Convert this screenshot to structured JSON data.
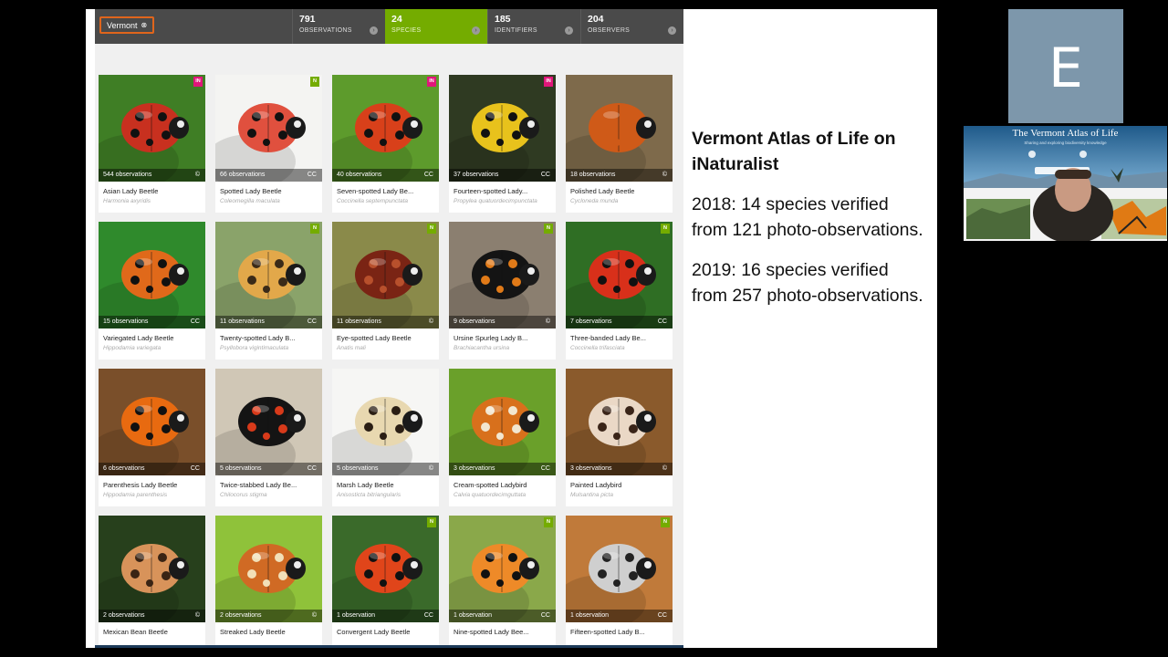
{
  "inat": {
    "place_filter": "Vermont",
    "stats": [
      {
        "count": "791",
        "label": "OBSERVATIONS",
        "active": false
      },
      {
        "count": "24",
        "label": "SPECIES",
        "active": true
      },
      {
        "count": "185",
        "label": "IDENTIFIERS",
        "active": false
      },
      {
        "count": "204",
        "label": "OBSERVERS",
        "active": false
      }
    ],
    "species": [
      {
        "common": "Asian Lady Beetle",
        "scientific": "Harmonia axyridis",
        "obs": "544 observations",
        "license": "©",
        "badge": "IN",
        "badge_color": "#e0167a",
        "bg": "#3f7e25",
        "body": "#c8301f",
        "spots": "#111"
      },
      {
        "common": "Spotted Lady Beetle",
        "scientific": "Coleomegilla maculata",
        "obs": "66 observations",
        "license": "CC",
        "badge": "N",
        "badge_color": "#74ac00",
        "bg": "#f4f4f2",
        "body": "#e0503e",
        "spots": "#111"
      },
      {
        "common": "Seven-spotted Lady Be...",
        "scientific": "Coccinella septempunctata",
        "obs": "40 observations",
        "license": "CC",
        "badge": "IN",
        "badge_color": "#e0167a",
        "bg": "#5d9b2c",
        "body": "#d8401a",
        "spots": "#111"
      },
      {
        "common": "Fourteen-spotted Lady...",
        "scientific": "Propylea quatuordecimpunctata",
        "obs": "37 observations",
        "license": "CC",
        "badge": "IN",
        "badge_color": "#e0167a",
        "bg": "#2f3a22",
        "body": "#e8c21c",
        "spots": "#111"
      },
      {
        "common": "Polished Lady Beetle",
        "scientific": "Cycloneda munda",
        "obs": "18 observations",
        "license": "©",
        "badge": "",
        "badge_color": "",
        "bg": "#7e6a4b",
        "body": "#cf5a18",
        "spots": "#cf5a18"
      },
      {
        "common": "Variegated Lady Beetle",
        "scientific": "Hippodamia variegata",
        "obs": "15 observations",
        "license": "CC",
        "badge": "",
        "badge_color": "",
        "bg": "#2f8a2c",
        "body": "#e0691a",
        "spots": "#111"
      },
      {
        "common": "Twenty-spotted Lady B...",
        "scientific": "Psyllobora vigintimaculata",
        "obs": "11 observations",
        "license": "CC",
        "badge": "N",
        "badge_color": "#74ac00",
        "bg": "#8aa36a",
        "body": "#e2a84a",
        "spots": "#3a2a18"
      },
      {
        "common": "Eye-spotted Lady Beetle",
        "scientific": "Anatis mali",
        "obs": "11 observations",
        "license": "©",
        "badge": "N",
        "badge_color": "#74ac00",
        "bg": "#8a8a4a",
        "body": "#7a2414",
        "spots": "#b8502c"
      },
      {
        "common": "Ursine Spurleg Lady B...",
        "scientific": "Brachiacantha ursina",
        "obs": "9 observations",
        "license": "©",
        "badge": "N",
        "badge_color": "#74ac00",
        "bg": "#8b7f70",
        "body": "#141414",
        "spots": "#e07a18"
      },
      {
        "common": "Three-banded Lady Be...",
        "scientific": "Coccinella trifasciata",
        "obs": "7 observations",
        "license": "CC",
        "badge": "N",
        "badge_color": "#74ac00",
        "bg": "#2f6e24",
        "body": "#d8301a",
        "spots": "#111"
      },
      {
        "common": "Parenthesis Lady Beetle",
        "scientific": "Hippodamia parenthesis",
        "obs": "6 observations",
        "license": "CC",
        "badge": "",
        "badge_color": "",
        "bg": "#7a4f2a",
        "body": "#e86a10",
        "spots": "#111"
      },
      {
        "common": "Twice-stabbed Lady Be...",
        "scientific": "Chilocorus stigma",
        "obs": "5 observations",
        "license": "CC",
        "badge": "",
        "badge_color": "",
        "bg": "#d0c7b6",
        "body": "#141414",
        "spots": "#d83a1a"
      },
      {
        "common": "Marsh Lady Beetle",
        "scientific": "Anisosticta bitriangularis",
        "obs": "5 observations",
        "license": "©",
        "badge": "",
        "badge_color": "",
        "bg": "#f6f6f4",
        "body": "#e8d8b0",
        "spots": "#2a1e14"
      },
      {
        "common": "Cream-spotted Ladybird",
        "scientific": "Calvia quatuordecimguttata",
        "obs": "3 observations",
        "license": "CC",
        "badge": "",
        "badge_color": "",
        "bg": "#6aa02a",
        "body": "#d8701c",
        "spots": "#f2e6d0"
      },
      {
        "common": "Painted Ladybird",
        "scientific": "Mulsantina picta",
        "obs": "3 observations",
        "license": "©",
        "badge": "",
        "badge_color": "",
        "bg": "#8a5a2c",
        "body": "#ead8c6",
        "spots": "#3a2418"
      },
      {
        "common": "Mexican Bean Beetle",
        "scientific": "",
        "obs": "2 observations",
        "license": "©",
        "badge": "",
        "badge_color": "",
        "bg": "#27401c",
        "body": "#d8935a",
        "spots": "#3a2414"
      },
      {
        "common": "Streaked Lady Beetle",
        "scientific": "",
        "obs": "2 observations",
        "license": "©",
        "badge": "",
        "badge_color": "",
        "bg": "#8fc23a",
        "body": "#d06a24",
        "spots": "#f2e0b8"
      },
      {
        "common": "Convergent Lady Beetle",
        "scientific": "",
        "obs": "1 observation",
        "license": "CC",
        "badge": "N",
        "badge_color": "#74ac00",
        "bg": "#3a6a2a",
        "body": "#e0451a",
        "spots": "#111"
      },
      {
        "common": "Nine-spotted Lady Bee...",
        "scientific": "",
        "obs": "1 observation",
        "license": "CC",
        "badge": "N",
        "badge_color": "#74ac00",
        "bg": "#8aa84a",
        "body": "#ee8a28",
        "spots": "#111"
      },
      {
        "common": "Fifteen-spotted Lady B...",
        "scientific": "",
        "obs": "1 observation",
        "license": "CC",
        "badge": "N",
        "badge_color": "#74ac00",
        "bg": "#c07a3a",
        "body": "#cfcfcf",
        "spots": "#222"
      }
    ]
  },
  "slide": {
    "title": "Vermont Atlas of Life on iNaturalist",
    "para1": "2018: 14 species verified from 121 photo-observations.",
    "para2": "2019: 16 species verified from 257 photo-observations."
  },
  "video": {
    "participant_initial": "E",
    "site_title": "The Vermont Atlas of Life",
    "site_subtitle": "Sharing and exploring biodiversity knowledge"
  }
}
